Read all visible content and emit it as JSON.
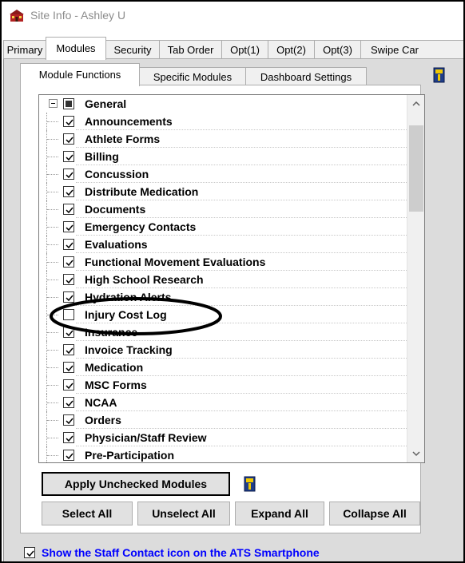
{
  "window": {
    "title": "Site Info - Ashley U"
  },
  "tabs": [
    {
      "label": "Primary",
      "active": false
    },
    {
      "label": "Modules",
      "active": true
    },
    {
      "label": "Security",
      "active": false
    },
    {
      "label": "Tab Order",
      "active": false
    },
    {
      "label": "Opt(1)",
      "active": false
    },
    {
      "label": "Opt(2)",
      "active": false
    },
    {
      "label": "Opt(3)",
      "active": false
    },
    {
      "label": "Swipe Car",
      "active": false
    }
  ],
  "subtabs": [
    {
      "label": "Module Functions",
      "active": true
    },
    {
      "label": "Specific Modules",
      "active": false
    },
    {
      "label": "Dashboard Settings",
      "active": false
    }
  ],
  "tree": {
    "group": {
      "label": "General",
      "state": "indeterminate",
      "expanded": true
    },
    "items": [
      {
        "label": "Announcements",
        "checked": true
      },
      {
        "label": "Athlete Forms",
        "checked": true
      },
      {
        "label": "Billing",
        "checked": true
      },
      {
        "label": "Concussion",
        "checked": true
      },
      {
        "label": "Distribute Medication",
        "checked": true
      },
      {
        "label": "Documents",
        "checked": true
      },
      {
        "label": "Emergency Contacts",
        "checked": true
      },
      {
        "label": "Evaluations",
        "checked": true
      },
      {
        "label": "Functional Movement Evaluations",
        "checked": true
      },
      {
        "label": "High School Research",
        "checked": true
      },
      {
        "label": "Hydration Alerts",
        "checked": true
      },
      {
        "label": "Injury Cost Log",
        "checked": false,
        "highlighted": true
      },
      {
        "label": "Insurance",
        "checked": true
      },
      {
        "label": "Invoice Tracking",
        "checked": true
      },
      {
        "label": "Medication",
        "checked": true
      },
      {
        "label": "MSC Forms",
        "checked": true
      },
      {
        "label": "NCAA",
        "checked": true
      },
      {
        "label": "Orders",
        "checked": true
      },
      {
        "label": "Physician/Staff Review",
        "checked": true
      },
      {
        "label": "Pre-Participation",
        "checked": true
      }
    ]
  },
  "buttons": {
    "apply_unchecked": "Apply Unchecked Modules",
    "select_all": "Select All",
    "unselect_all": "Unselect All",
    "expand_all": "Expand All",
    "collapse_all": "Collapse All"
  },
  "bottom_option": {
    "label": "Show the Staff Contact icon on the ATS Smartphone",
    "checked": true
  },
  "colors": {
    "link_blue": "#0000ff",
    "panel_gray": "#dcdcdc",
    "highlight_ellipse": "#000000",
    "help_icon_blue": "#1f3d8a",
    "help_icon_yellow": "#f0c800"
  },
  "icons": {
    "app": "site-info-app-icon",
    "help": "help-book-icon",
    "check": "checkmark-icon"
  }
}
